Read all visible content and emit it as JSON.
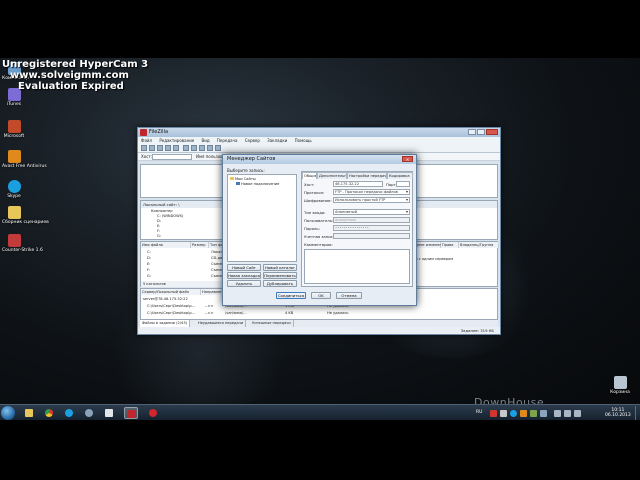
{
  "watermark": {
    "line1": "Unregistered HyperCam 3",
    "line2": "www.solveigmm.com",
    "line3": "Evaluation Expired"
  },
  "brand_mark": "DownHouse",
  "desktop_icons": [
    {
      "label": "Компьютер",
      "icon": "computer-icon",
      "color": "#6a9ccc"
    },
    {
      "label": "iTunes",
      "icon": "itunes-icon",
      "color": "#7d6bd6"
    },
    {
      "label": "Microsoft",
      "icon": "office-icon",
      "color": "#c2492a"
    },
    {
      "label": "Avast Free Antivirus",
      "icon": "antivirus-icon",
      "color": "#e08a1e"
    },
    {
      "label": "Skype",
      "icon": "skype-icon",
      "color": "#1aa0e0"
    },
    {
      "label": "Сборник сценариев",
      "icon": "folder-icon",
      "color": "#e7c65a"
    },
    {
      "label": "Counter-Strike 1.6",
      "icon": "game-icon",
      "color": "#c33a3a"
    }
  ],
  "recycle_bin": {
    "label": "Корзина",
    "icon": "recycle-bin-icon"
  },
  "filezilla": {
    "title": "FileZilla",
    "menu": [
      "Файл",
      "Редактирование",
      "Вид",
      "Передача",
      "Сервер",
      "Закладки",
      "Помощь"
    ],
    "quickconnect": {
      "host_label": "Хост:",
      "user_label": "Имя пользователя:",
      "pass_label": "Пароль:",
      "port_label": "Порт:",
      "button": "Быстрое соединение"
    },
    "local_site_label": "Локальный сайт:",
    "local_site_value": "\\",
    "remote_site_label": "Удаленный сайт:",
    "local_tree": [
      "Компьютер",
      "C: (WINDOWS)",
      "D:",
      "E:",
      "F:",
      "G:"
    ],
    "local_columns": [
      "Имя файла",
      "Размер",
      "Тип файла"
    ],
    "local_files": [
      {
        "name": "C:",
        "size": "",
        "type": "Локальный"
      },
      {
        "name": "D:",
        "size": "",
        "type": "CD-дисковод"
      },
      {
        "name": "E:",
        "size": "",
        "type": "Съемный"
      },
      {
        "name": "F:",
        "size": "",
        "type": "Съемный"
      },
      {
        "name": "G:",
        "size": "",
        "type": "Съемный"
      }
    ],
    "local_summary": "5 каталогов",
    "remote_columns": [
      "Имя файла",
      "Размер",
      "Тип файла",
      "Последнее изменение",
      "Права",
      "Владелец/Группа"
    ],
    "remote_empty": "Нет соединения ни с одним сервером",
    "queue_columns": [
      "Сервер/Локальный файл",
      "Направление",
      "Файл на сервере",
      "Размер",
      "Приоритет",
      "Состояние"
    ],
    "queue_rows": [
      {
        "server": "server@78.46.175.32:22",
        "dir": "",
        "remote": "",
        "size": "",
        "state": ""
      },
      {
        "server": "C:\\Users\\Серг\\Desktop\\p...",
        "dir": "-->>",
        "remote": "/var/www/...",
        "size": "1 MB",
        "state": "Не удалось"
      },
      {
        "server": "C:\\Users\\Серг\\Desktop\\p...",
        "dir": "-->>",
        "remote": "/var/www/...",
        "size": "4 KB",
        "state": "Не удалось"
      }
    ],
    "tabs": [
      "Файлы в задании (2/43)",
      "Неудавшиеся передачи",
      "Успешные передачи"
    ],
    "status": "Задание: 319 КБ"
  },
  "site_manager": {
    "title": "Менеджер Сайтов",
    "select_label": "Выберите запись:",
    "tree": [
      "Мои Сайты",
      "Новое подключение"
    ],
    "buttons": {
      "new_site": "Новый Сайт",
      "new_folder": "Новый каталог",
      "new_bookmark": "Новая закладка",
      "rename": "Переименовать",
      "delete": "Удалить",
      "duplicate": "Дублировать"
    },
    "tabs": [
      "Общие",
      "Дополнительно",
      "Настройки передачи",
      "Кодировка"
    ],
    "labels": {
      "host": "Хост:",
      "port": "Порт:",
      "protocol": "Протокол:",
      "encryption": "Шифрование:",
      "logon_type": "Тип входа:",
      "user": "Пользователь:",
      "password": "Пароль:",
      "account": "Учетная запись:",
      "comments": "Комментарии:"
    },
    "values": {
      "host": "46.175.32.22",
      "port": "",
      "protocol": "FTP - Протокол передачи файлов",
      "encryption": "Использовать простой FTP",
      "logon_type": "Анонимный",
      "user": "anonymous",
      "password": "••••••••••••••••",
      "account": ""
    },
    "footer": {
      "connect": "Соединиться",
      "ok": "OK",
      "cancel": "Отмена"
    }
  },
  "tray": {
    "time": "10:11",
    "date": "06.10.2013",
    "lang": "RU"
  }
}
